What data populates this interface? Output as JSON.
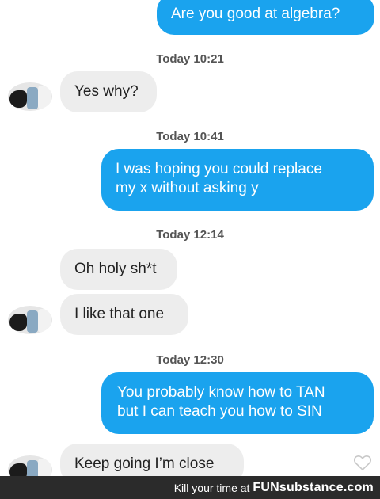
{
  "messages": {
    "m1": "Are you good at algebra?",
    "ts1": "Today 10:21",
    "m2": "Yes why?",
    "ts2": "Today 10:41",
    "m3a": "I was hoping you could replace",
    "m3b": "my x without asking y",
    "ts3": "Today 12:14",
    "m4": "Oh holy sh*t",
    "m5": "I like that one",
    "ts4": "Today 12:30",
    "m6a": "You probably know how to TAN",
    "m6b": "but I can teach you how to SIN",
    "m7": "Keep going I’m close"
  },
  "icons": {
    "heart": "heart-icon",
    "avatar": "avatar"
  },
  "colors": {
    "outgoing_bubble": "#1aa3ee",
    "incoming_bubble": "#ededed",
    "footer": "#2b2b2b"
  },
  "footer": {
    "text": "Kill your time at",
    "brand": "FUNsubstance.com"
  }
}
